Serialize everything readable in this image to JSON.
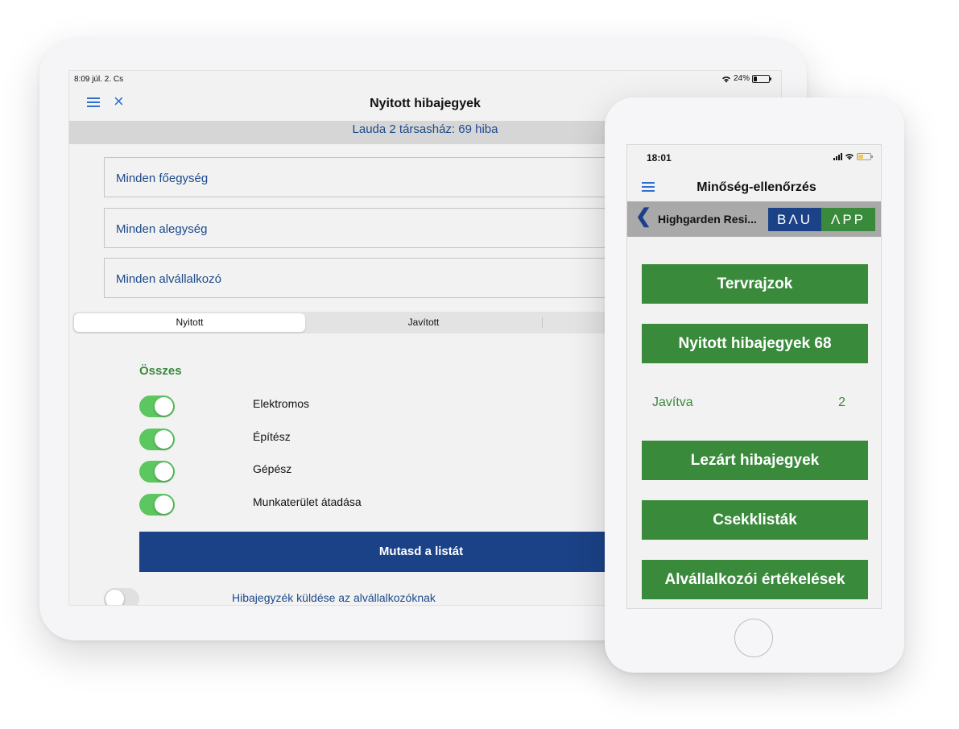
{
  "tablet": {
    "status": {
      "time": "8:09",
      "date": "júl. 2. Cs",
      "battery": "24%",
      "battery_level": 0.24
    },
    "nav": {
      "title": "Nyitott hibajegyek"
    },
    "subheader": "Lauda 2 társasház: 69 hiba",
    "filters": {
      "main_unit": "Minden főegység",
      "sub_unit": "Minden alegység",
      "subcontractor": "Minden alvállalkozó"
    },
    "segments": [
      "Nyitott",
      "Javított"
    ],
    "selected_segment": "Nyitott",
    "all_label": "Összes",
    "categories": [
      {
        "label": "Elektromos",
        "on": true
      },
      {
        "label": "Építész",
        "on": true
      },
      {
        "label": "Gépész",
        "on": true
      },
      {
        "label": "Munkaterület átadása",
        "on": true
      }
    ],
    "show_list_button": "Mutasd a listát",
    "send_label": "Hibajegyzék küldése az alvállalkozóknak",
    "send_on": false
  },
  "phone": {
    "status": {
      "time": "18:01"
    },
    "nav": {
      "title": "Minőség-ellenőrzés"
    },
    "project": "Highgarden Resi...",
    "logo": {
      "left": "BΛU",
      "right": "ΛPP"
    },
    "buttons": {
      "plans": "Tervrajzok",
      "open_tickets": "Nyitott hibajegyek  68",
      "closed_tickets": "Lezárt hibajegyek",
      "checklists": "Csekklisták",
      "ratings": "Alvállalkozói értékelések"
    },
    "fixed": {
      "label": "Javítva",
      "count": "2"
    }
  },
  "colors": {
    "blue": "#1b4287",
    "green": "#3a8a3c",
    "toggle_green": "#5cc65f",
    "link_blue": "#1d4a8c",
    "icon_blue": "#2f6fd0"
  }
}
